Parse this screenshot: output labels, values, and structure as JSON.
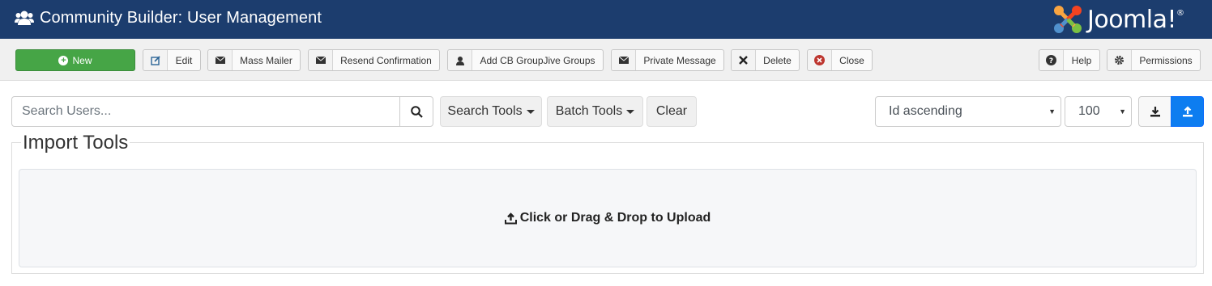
{
  "header": {
    "title": "Community Builder: User Management",
    "title_icon": "users-icon",
    "logo_text": "Joomla!",
    "logo_mark": "®"
  },
  "toolbar": {
    "new_label": "New",
    "edit_label": "Edit",
    "mass_mailer_label": "Mass Mailer",
    "resend_label": "Resend Confirmation",
    "groupjive_label": "Add CB GroupJive Groups",
    "private_message_label": "Private Message",
    "delete_label": "Delete",
    "close_label": "Close",
    "help_label": "Help",
    "permissions_label": "Permissions"
  },
  "filters": {
    "search_placeholder": "Search Users...",
    "search_tools_label": "Search Tools",
    "batch_tools_label": "Batch Tools",
    "clear_label": "Clear",
    "sort_value": "Id ascending",
    "limit_value": "100"
  },
  "import": {
    "legend": "Import Tools",
    "dropzone_label": "Click or Drag & Drop to Upload"
  },
  "colors": {
    "header_bg": "#1c3d6e",
    "new_button": "#46a546",
    "upload_button": "#0d7df0"
  }
}
